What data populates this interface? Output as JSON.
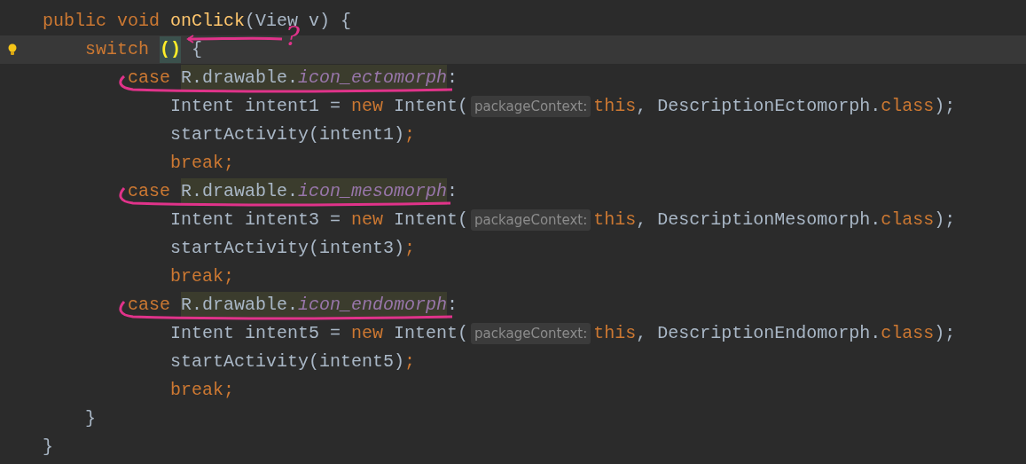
{
  "editor": {
    "lines": [
      {
        "current": false,
        "bulb": false,
        "tokens": [
          {
            "kind": "keyword",
            "text": "public void "
          },
          {
            "kind": "method",
            "text": "onClick"
          },
          {
            "kind": "plain",
            "text": "(View v) {"
          }
        ]
      },
      {
        "current": true,
        "bulb": true,
        "tokens": [
          {
            "kind": "keyword",
            "text": "    switch "
          },
          {
            "kind": "paren",
            "text": "()"
          },
          {
            "kind": "plain",
            "text": " {"
          }
        ]
      },
      {
        "current": false,
        "bulb": false,
        "tokens": [
          {
            "kind": "keyword",
            "text": "        case "
          },
          {
            "kind": "ref",
            "text": "R.drawable."
          },
          {
            "kind": "field",
            "text": "icon_ectomorph"
          },
          {
            "kind": "plain",
            "text": ":"
          }
        ]
      },
      {
        "current": false,
        "bulb": false,
        "tokens": [
          {
            "kind": "plain",
            "text": "            Intent intent1 = "
          },
          {
            "kind": "keyword",
            "text": "new "
          },
          {
            "kind": "plain",
            "text": "Intent("
          },
          {
            "kind": "hint",
            "text": "packageContext:"
          },
          {
            "kind": "keyword",
            "text": "this"
          },
          {
            "kind": "plain",
            "text": ", DescriptionEctomorph."
          },
          {
            "kind": "keyword",
            "text": "class"
          },
          {
            "kind": "plain",
            "text": ");"
          }
        ]
      },
      {
        "current": false,
        "bulb": false,
        "tokens": [
          {
            "kind": "plain",
            "text": "            startActivity(intent1)"
          },
          {
            "kind": "keyword",
            "text": ";"
          }
        ]
      },
      {
        "current": false,
        "bulb": false,
        "tokens": [
          {
            "kind": "keyword",
            "text": "            break;"
          }
        ]
      },
      {
        "current": false,
        "bulb": false,
        "tokens": [
          {
            "kind": "keyword",
            "text": "        case "
          },
          {
            "kind": "ref",
            "text": "R.drawable."
          },
          {
            "kind": "field",
            "text": "icon_mesomorph"
          },
          {
            "kind": "plain",
            "text": ":"
          }
        ]
      },
      {
        "current": false,
        "bulb": false,
        "tokens": [
          {
            "kind": "plain",
            "text": "            Intent intent3 = "
          },
          {
            "kind": "keyword",
            "text": "new "
          },
          {
            "kind": "plain",
            "text": "Intent("
          },
          {
            "kind": "hint",
            "text": "packageContext:"
          },
          {
            "kind": "keyword",
            "text": "this"
          },
          {
            "kind": "plain",
            "text": ", DescriptionMesomorph."
          },
          {
            "kind": "keyword",
            "text": "class"
          },
          {
            "kind": "plain",
            "text": ");"
          }
        ]
      },
      {
        "current": false,
        "bulb": false,
        "tokens": [
          {
            "kind": "plain",
            "text": "            startActivity(intent3)"
          },
          {
            "kind": "keyword",
            "text": ";"
          }
        ]
      },
      {
        "current": false,
        "bulb": false,
        "tokens": [
          {
            "kind": "keyword",
            "text": "            break;"
          }
        ]
      },
      {
        "current": false,
        "bulb": false,
        "tokens": [
          {
            "kind": "keyword",
            "text": "        case "
          },
          {
            "kind": "ref",
            "text": "R.drawable."
          },
          {
            "kind": "field",
            "text": "icon_endomorph"
          },
          {
            "kind": "plain",
            "text": ":"
          }
        ]
      },
      {
        "current": false,
        "bulb": false,
        "tokens": [
          {
            "kind": "plain",
            "text": "            Intent intent5 = "
          },
          {
            "kind": "keyword",
            "text": "new "
          },
          {
            "kind": "plain",
            "text": "Intent("
          },
          {
            "kind": "hint",
            "text": "packageContext:"
          },
          {
            "kind": "keyword",
            "text": "this"
          },
          {
            "kind": "plain",
            "text": ", DescriptionEndomorph."
          },
          {
            "kind": "keyword",
            "text": "class"
          },
          {
            "kind": "plain",
            "text": ");"
          }
        ]
      },
      {
        "current": false,
        "bulb": false,
        "tokens": [
          {
            "kind": "plain",
            "text": "            startActivity(intent5)"
          },
          {
            "kind": "keyword",
            "text": ";"
          }
        ]
      },
      {
        "current": false,
        "bulb": false,
        "tokens": [
          {
            "kind": "keyword",
            "text": "            break;"
          }
        ]
      },
      {
        "current": false,
        "bulb": false,
        "tokens": [
          {
            "kind": "plain",
            "text": "    }"
          }
        ]
      },
      {
        "current": false,
        "bulb": false,
        "tokens": [
          {
            "kind": "plain",
            "text": "}"
          }
        ]
      }
    ]
  },
  "annotation": {
    "question_mark": "?"
  }
}
